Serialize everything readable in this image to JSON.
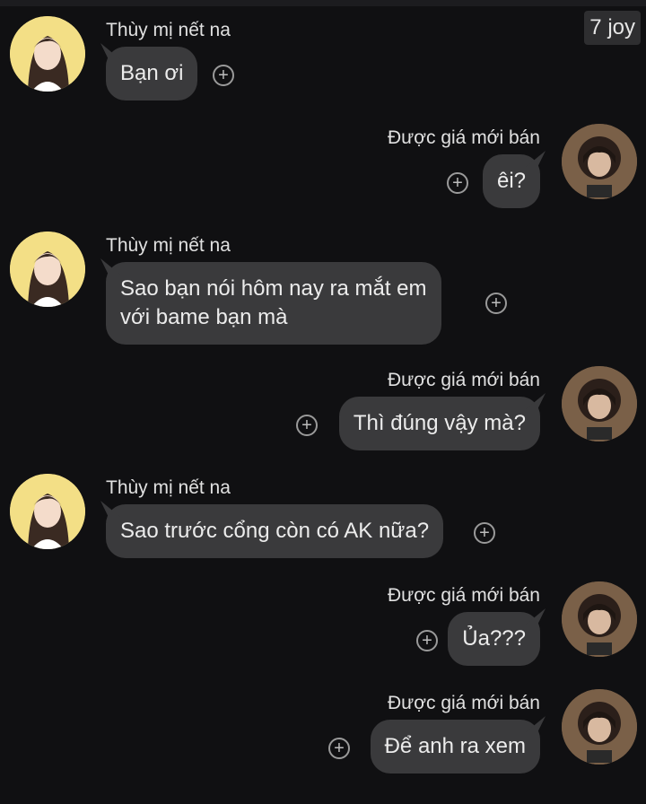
{
  "corner_badge": "7 joy",
  "icons": {
    "reaction": "plus-circle-icon",
    "reaction_glyph": "+"
  },
  "colors": {
    "background": "#101012",
    "bubble": "#3a3a3c",
    "left_avatar_bg": "#f3df86"
  },
  "messages": [
    {
      "side": "left",
      "sender": "Thùy mị nết na",
      "text": "Bạn ơi"
    },
    {
      "side": "right",
      "sender": "Được giá mới bán",
      "text": "êi?"
    },
    {
      "side": "left",
      "sender": "Thùy mị nết na",
      "text": "Sao bạn nói hôm nay ra mắt em\nvới bame bạn mà"
    },
    {
      "side": "right",
      "sender": "Được giá mới bán",
      "text": "Thì đúng vậy mà?"
    },
    {
      "side": "left",
      "sender": "Thùy mị nết na",
      "text": "Sao trước cổng còn có AK nữa?"
    },
    {
      "side": "right",
      "sender": "Được giá mới bán",
      "text": "Ủa???"
    },
    {
      "side": "right",
      "sender": "Được giá mới bán",
      "text": "Để anh ra xem"
    }
  ]
}
